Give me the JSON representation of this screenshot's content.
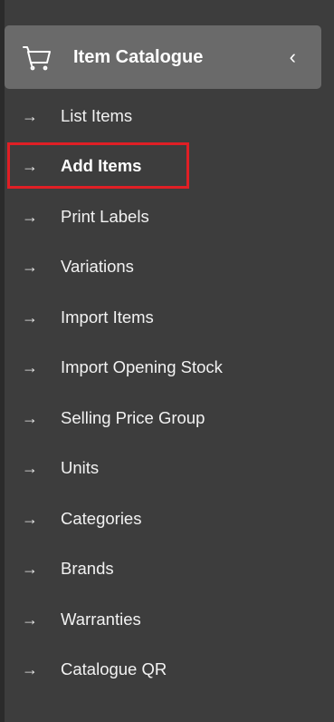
{
  "sidebar": {
    "group": {
      "title": "Item Catalogue",
      "icon": "cart-icon",
      "collapse_glyph": "‹"
    },
    "arrow_glyph": "→",
    "items": [
      {
        "label": "List Items",
        "active": false
      },
      {
        "label": "Add Items",
        "active": true
      },
      {
        "label": "Print Labels",
        "active": false
      },
      {
        "label": "Variations",
        "active": false
      },
      {
        "label": "Import Items",
        "active": false
      },
      {
        "label": "Import Opening Stock",
        "active": false
      },
      {
        "label": "Selling Price Group",
        "active": false
      },
      {
        "label": "Units",
        "active": false
      },
      {
        "label": "Categories",
        "active": false
      },
      {
        "label": "Brands",
        "active": false
      },
      {
        "label": "Warranties",
        "active": false
      },
      {
        "label": "Catalogue QR",
        "active": false
      }
    ]
  },
  "colors": {
    "sidebar_bg": "#3d3d3d",
    "header_bg": "#6a6a6a",
    "highlight": "#e01f25",
    "text": "#ffffff"
  }
}
